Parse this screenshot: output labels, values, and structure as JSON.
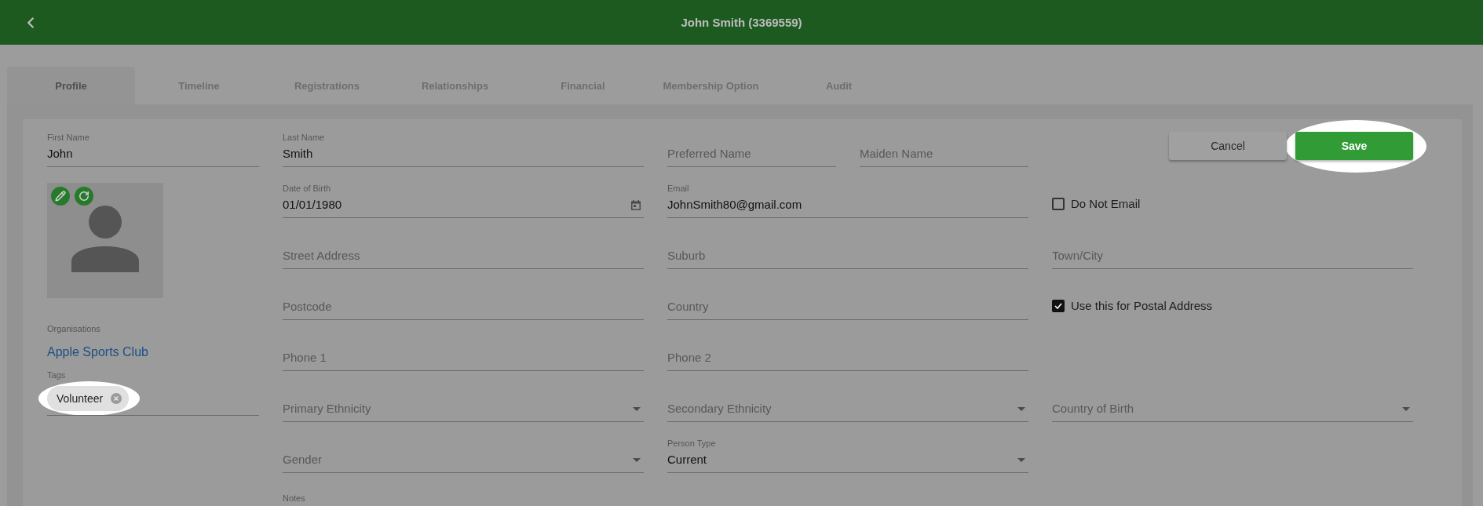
{
  "header": {
    "title": "John Smith (3369559)"
  },
  "tabs": [
    {
      "label": "Profile",
      "selected": true
    },
    {
      "label": "Timeline",
      "selected": false
    },
    {
      "label": "Registrations",
      "selected": false
    },
    {
      "label": "Relationships",
      "selected": false
    },
    {
      "label": "Financial",
      "selected": false
    },
    {
      "label": "Membership Option",
      "selected": false
    },
    {
      "label": "Audit",
      "selected": false
    }
  ],
  "profile": {
    "first_name": {
      "kind": "text",
      "label": "First Name",
      "value": "John"
    },
    "organisations": {
      "label": "Organisations",
      "items": [
        "Apple Sports Club"
      ]
    },
    "tags": {
      "label": "Tags",
      "items": [
        {
          "label": "Volunteer",
          "highlighted": true
        }
      ]
    },
    "actions": [
      {
        "label": "Cancel",
        "kind": "secondary",
        "highlighted": false
      },
      {
        "label": "Save",
        "kind": "primary",
        "highlighted": true
      }
    ],
    "rows": [
      {
        "cells": [
          {
            "kind": "text",
            "label": "Last Name",
            "value": "Smith"
          },
          {
            "kind": "group",
            "fields": [
              {
                "kind": "text",
                "label": "Preferred Name"
              },
              {
                "kind": "text",
                "label": "Maiden Name"
              }
            ]
          }
        ]
      },
      {
        "cells": [
          {
            "kind": "date",
            "label": "Date of Birth",
            "value": "01/01/1980"
          },
          {
            "kind": "text",
            "label": "Email",
            "value": "JohnSmith80@gmail.com"
          },
          {
            "kind": "checkbox",
            "label": "Do Not Email",
            "checked": false
          }
        ]
      },
      {
        "cells": [
          {
            "kind": "text",
            "label": "Street Address"
          },
          {
            "kind": "text",
            "label": "Suburb"
          },
          {
            "kind": "text",
            "label": "Town/City"
          }
        ]
      },
      {
        "cells": [
          {
            "kind": "text",
            "label": "Postcode"
          },
          {
            "kind": "text",
            "label": "Country"
          },
          {
            "kind": "checkbox",
            "label": "Use this for Postal Address",
            "checked": true
          }
        ]
      },
      {
        "cells": [
          {
            "kind": "text",
            "label": "Phone 1"
          },
          {
            "kind": "text",
            "label": "Phone 2"
          }
        ]
      },
      {
        "cells": [
          {
            "kind": "select",
            "label": "Primary Ethnicity"
          },
          {
            "kind": "select",
            "label": "Secondary Ethnicity"
          },
          {
            "kind": "select",
            "label": "Country of Birth"
          }
        ]
      },
      {
        "cells": [
          {
            "kind": "select",
            "label": "Gender"
          },
          {
            "kind": "select",
            "label": "Person Type",
            "value": "Current"
          }
        ]
      },
      {
        "cells": [
          {
            "kind": "textarea",
            "label": "Notes"
          }
        ]
      }
    ]
  }
}
